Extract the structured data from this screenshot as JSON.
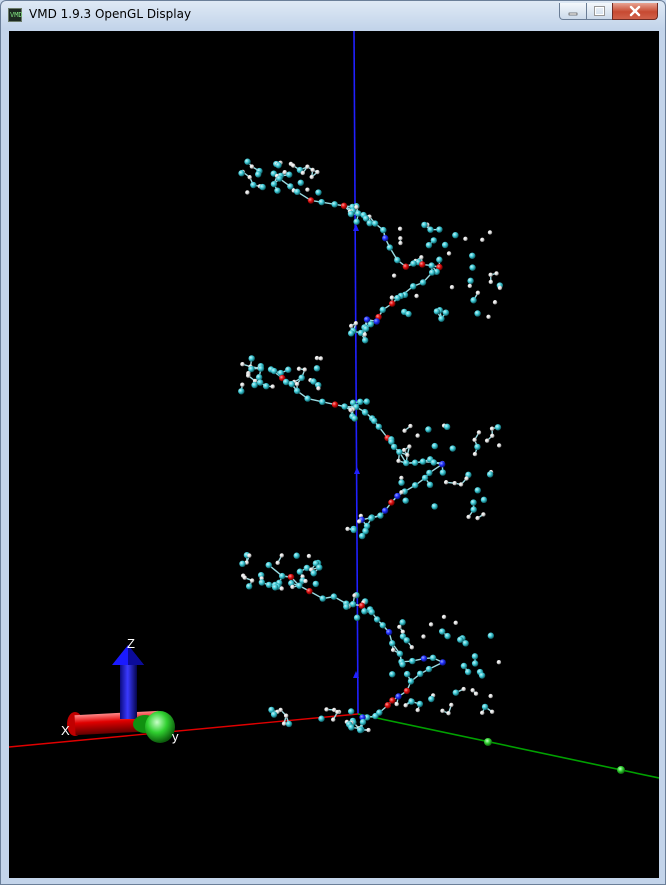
{
  "window": {
    "title": "VMD 1.9.3 OpenGL Display",
    "icon": "vmd-app-icon",
    "icon_text": "VMD",
    "controls": [
      "minimize-icon",
      "maximize-icon",
      "close-icon"
    ]
  },
  "axes_indicator": {
    "x_label": "X",
    "y_label": "y",
    "z_label": "Z",
    "colors": {
      "x": "#ff0000",
      "y": "#00c000",
      "z": "#0000ff"
    }
  },
  "scene": {
    "background": "#000000",
    "atom_colors": {
      "carbon": "#3ec9d6",
      "hydrogen": "#e8e8e8",
      "oxygen": "#e01010",
      "nitrogen": "#2030ff"
    },
    "helix_turns": 3
  }
}
